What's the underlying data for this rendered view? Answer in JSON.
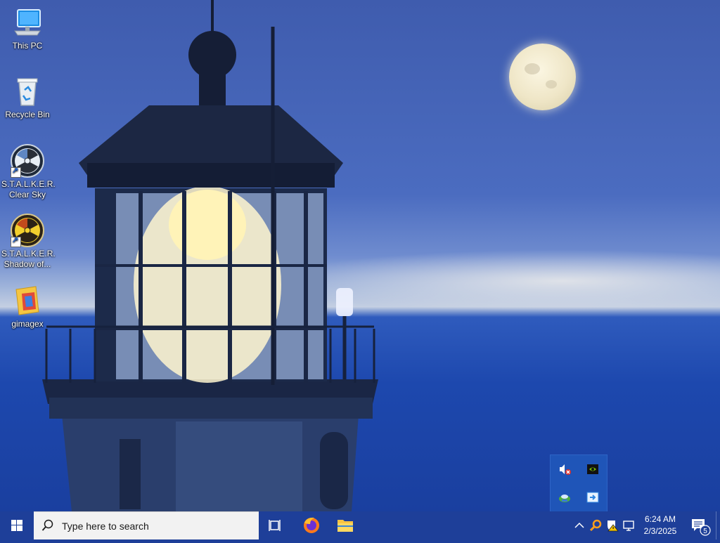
{
  "desktop": {
    "icons": [
      {
        "label": "This PC",
        "icon": "this-pc-icon"
      },
      {
        "label": "Recycle Bin",
        "icon": "recycle-bin-icon"
      },
      {
        "label_line1": "S.T.A.L.K.E.R.",
        "label_line2": "Clear Sky",
        "icon": "stalker-clear-sky-icon"
      },
      {
        "label_line1": "S.T.A.L.K.E.R.",
        "label_line2": "Shadow of...",
        "icon": "stalker-shadow-icon"
      },
      {
        "label": "gimagex",
        "icon": "gimagex-folder-icon"
      }
    ]
  },
  "taskbar": {
    "search_placeholder": "Type here to search",
    "pinned": [
      "task-view-icon",
      "firefox-icon",
      "file-explorer-icon"
    ],
    "tray_icons": [
      "show-hidden-icons-chevron",
      "search-tool-icon",
      "security-warning-icon",
      "network-icon"
    ],
    "clock_time": "6:24 AM",
    "clock_date": "2/3/2025",
    "notification_count": "5"
  },
  "tray_flyout": {
    "icons": [
      "volume-muted-icon",
      "nvidia-icon",
      "network-app-icon",
      "remote-app-icon"
    ]
  },
  "colors": {
    "taskbar": "#1e3f99",
    "search_box": "#f2f2f2",
    "flyout": "#1f55b8"
  }
}
